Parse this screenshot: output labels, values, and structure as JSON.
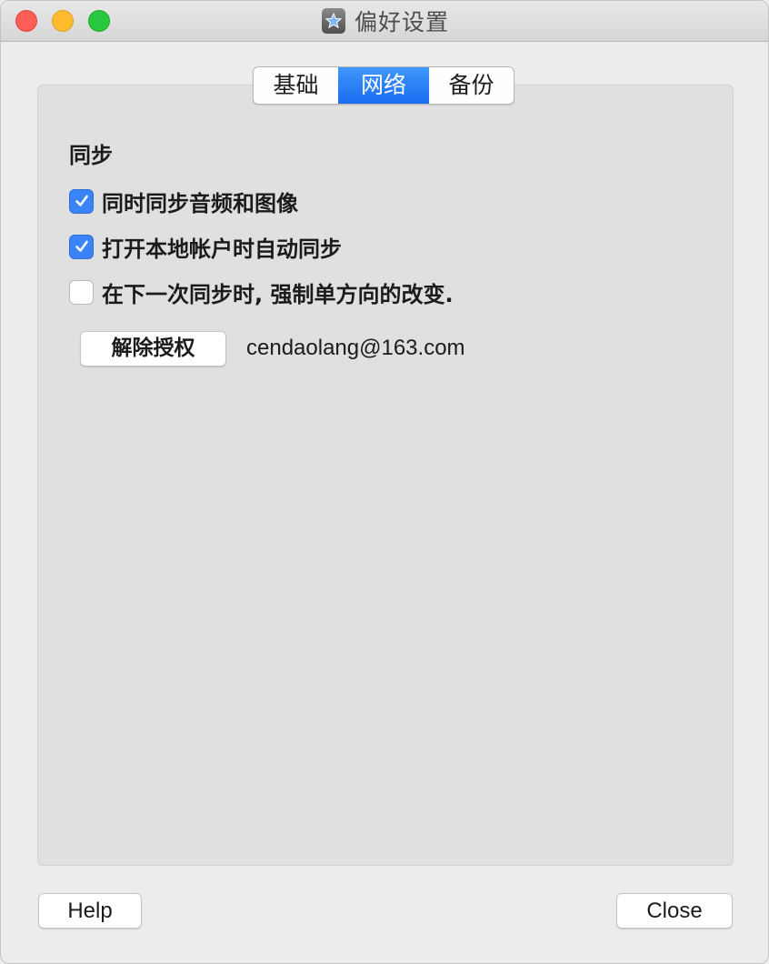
{
  "window": {
    "title": "偏好设置",
    "app_icon": "app-star-icon"
  },
  "tabs": [
    {
      "label": "基础",
      "active": false
    },
    {
      "label": "网络",
      "active": true
    },
    {
      "label": "备份",
      "active": false
    }
  ],
  "sync": {
    "section_title": "同步",
    "options": [
      {
        "label": "同时同步音频和图像",
        "checked": true
      },
      {
        "label": "打开本地帐户时自动同步",
        "checked": true
      },
      {
        "label": "在下一次同步时, 强制单方向的改变.",
        "checked": false
      }
    ],
    "deauthorize_label": "解除授权",
    "account_email": "cendaolang@163.com"
  },
  "footer": {
    "help_label": "Help",
    "close_label": "Close"
  },
  "colors": {
    "accent": "#1a6cf0",
    "checkbox_checked": "#3a84f7",
    "panel_background": "#e0e0e0"
  }
}
